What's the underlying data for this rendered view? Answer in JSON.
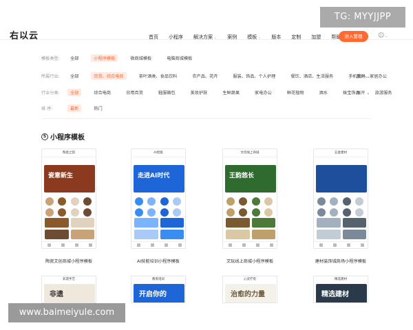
{
  "header": {
    "logo": "右以云",
    "nav": [
      "首页",
      "小程序",
      "解决方案",
      "案例",
      "模板",
      "版本",
      "定制",
      "加盟",
      "帮助"
    ],
    "nav_dropdown": [
      false,
      false,
      true,
      false,
      true,
      false,
      false,
      false,
      false
    ],
    "cta_label": "进入管理",
    "user_icon": "user-icon"
  },
  "watermark_tg": "TG: MYYJJPP",
  "watermark_site": "www.baimeiyule.com",
  "filters": {
    "type": {
      "label": "模板类型:",
      "options": [
        "全部",
        "小程序模板",
        "微商城模板",
        "电脑商城模板"
      ],
      "active": 1
    },
    "industry": {
      "label": "所属行业:",
      "options": [
        "全部",
        "百货、综合电商",
        "茶叶酒类、食品饮料",
        "农产品、花卉",
        "服装、饰品、个人护理",
        "餐饮、酒店、生活服务",
        "手机数码、家居办公"
      ],
      "active": 1,
      "more": "展开"
    },
    "trade": {
      "label": "行业分类:",
      "options": [
        "全部",
        "综合电商",
        "日用百货",
        "鞋服箱包",
        "美妆护肤",
        "生鲜蔬果",
        "家电办公",
        "鲜花植物",
        "酒水",
        "珠宝饰品",
        "旅游服务"
      ],
      "active": 0,
      "more": "展开"
    },
    "sort": {
      "label": "排  序:",
      "options": [
        "最新",
        "热门"
      ],
      "active": 0
    }
  },
  "section": {
    "title": "小程序模板"
  },
  "templates": [
    {
      "header": "陶瓷之韵",
      "banner": "瓷意新生",
      "caption": "陶瓷文创商城小程序模板",
      "accent": "#8b3a1f"
    },
    {
      "header": "AI智能",
      "banner": "走进AI时代",
      "caption": "AI技能培训小程序模板",
      "accent": "#1e66d8"
    },
    {
      "header": "文玩线上商城",
      "banner": "王韵悠长",
      "caption": "文玩线上商城小程序模板",
      "accent": "#2f6b2f"
    },
    {
      "header": "五金建材",
      "banner": "",
      "caption": "建材装饰城商场小程序模板",
      "accent": "#1d4f9c"
    }
  ],
  "templates_row2": [
    {
      "header": "非遗手艺",
      "banner": "非遗"
    },
    {
      "header": "教育培训",
      "banner": "开启你的"
    },
    {
      "header": "心灵疗愈",
      "banner": "治愈的力量"
    },
    {
      "header": "精选建材",
      "banner": "精选建材"
    }
  ]
}
